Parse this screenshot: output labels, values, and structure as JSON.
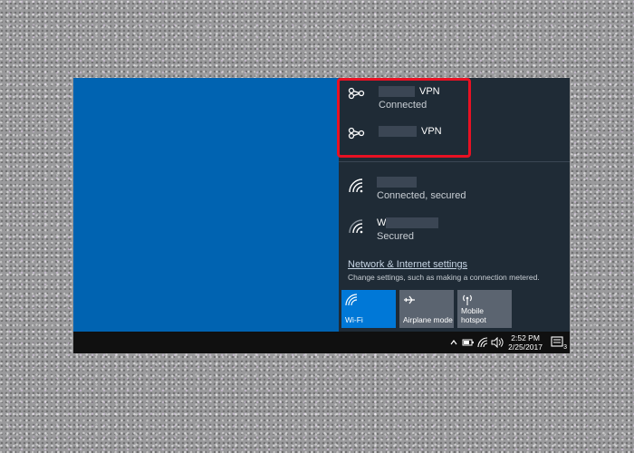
{
  "vpn": [
    {
      "name_suffix": "VPN",
      "status": "Connected"
    },
    {
      "name_suffix": "VPN",
      "status": ""
    }
  ],
  "wifi": [
    {
      "name_prefix": "",
      "status": "Connected, secured"
    },
    {
      "name_prefix": "W",
      "status": "Secured"
    }
  ],
  "settings": {
    "link": "Network & Internet settings",
    "description": "Change settings, such as making a connection metered."
  },
  "quick_actions": [
    {
      "label": "Wi-Fi",
      "icon": "wifi-icon",
      "active": true
    },
    {
      "label": "Airplane mode",
      "icon": "airplane-icon",
      "active": false
    },
    {
      "label": "Mobile hotspot",
      "icon": "hotspot-icon",
      "active": false
    }
  ],
  "taskbar": {
    "time": "2:52 PM",
    "date": "2/25/2017",
    "notification_count": "3"
  },
  "colors": {
    "accent": "#0078d7",
    "highlight": "#e81123",
    "desktop": "#0063b1",
    "panel": "#1f2b36"
  }
}
